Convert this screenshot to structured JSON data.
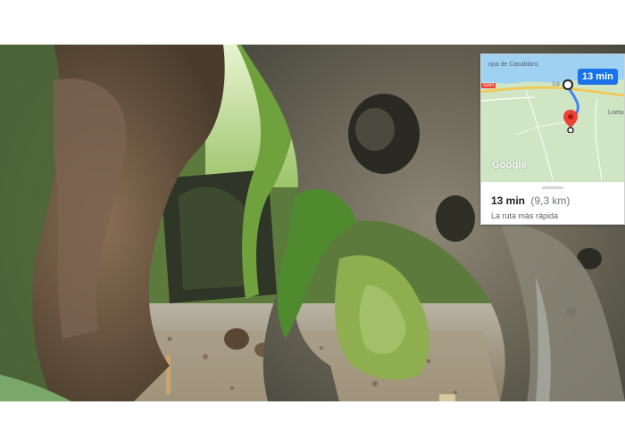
{
  "photo": {
    "subject": "cave-arch-forest-path"
  },
  "map_card": {
    "duration_chip": "13 min",
    "place_labels": {
      "top_left": "opa de\nCasablanc",
      "mid": "Lo",
      "right": "Loeta"
    },
    "road_badge": "SAR",
    "logo": "Google",
    "summary_time": "13 min",
    "summary_distance": "(9,3 km)",
    "route_note": "La ruta más rápida",
    "colors": {
      "route": "#4285f4",
      "chip": "#1a73e8",
      "pin": "#ea4335",
      "highway": "#f6c64b",
      "land": "#cfe5c4",
      "water": "#9fd1f2"
    }
  }
}
